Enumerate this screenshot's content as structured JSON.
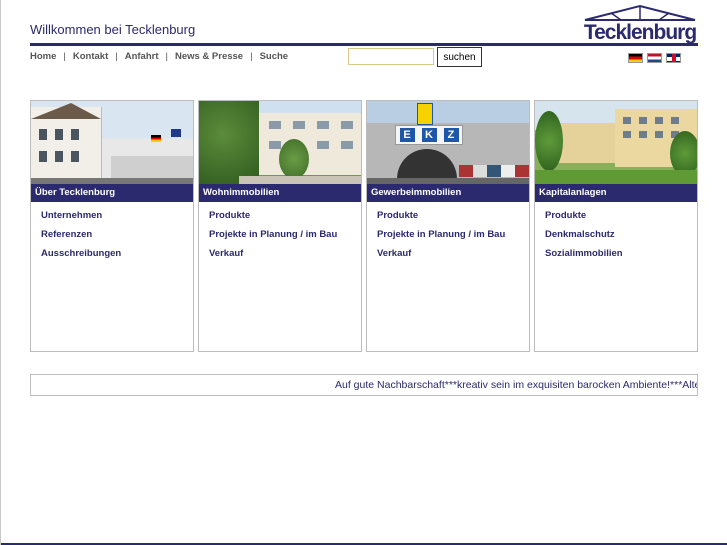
{
  "header": {
    "welcome": "Willkommen bei Tecklenburg",
    "logo_text": "Tecklenburg"
  },
  "nav": {
    "items": [
      {
        "label": "Home"
      },
      {
        "label": "Kontakt"
      },
      {
        "label": "Anfahrt"
      },
      {
        "label": "News & Presse"
      },
      {
        "label": "Suche"
      }
    ],
    "separator": "|"
  },
  "search": {
    "value": "",
    "placeholder": "",
    "button_label": "suchen"
  },
  "languages": [
    {
      "code": "de",
      "icon": "flag-germany-icon"
    },
    {
      "code": "nl",
      "icon": "flag-netherlands-icon"
    },
    {
      "code": "en",
      "icon": "flag-uk-icon"
    }
  ],
  "boxes": [
    {
      "title": "Über Tecklenburg",
      "links": [
        "Unternehmen",
        "Referenzen",
        "Ausschreibungen"
      ]
    },
    {
      "title": "Wohnimmobilien",
      "links": [
        "Produkte",
        "Projekte in Planung / im Bau",
        "Verkauf"
      ]
    },
    {
      "title": "Gewerbeimmobilien",
      "links": [
        "Produkte",
        "Projekte in Planung / im Bau",
        "Verkauf"
      ]
    },
    {
      "title": "Kapitalanlagen",
      "links": [
        "Produkte",
        "Denkmalschutz",
        "Sozialimmobilien"
      ]
    }
  ],
  "ekz_sign": [
    "E",
    "K",
    "Z"
  ],
  "ticker": {
    "text": "Auf gute Nachbarschaft***kreativ sein im exquisiten barocken Ambiente!***Alte G"
  },
  "colors": {
    "brand": "#2b2a6e",
    "search_border": "#d8c98a"
  }
}
